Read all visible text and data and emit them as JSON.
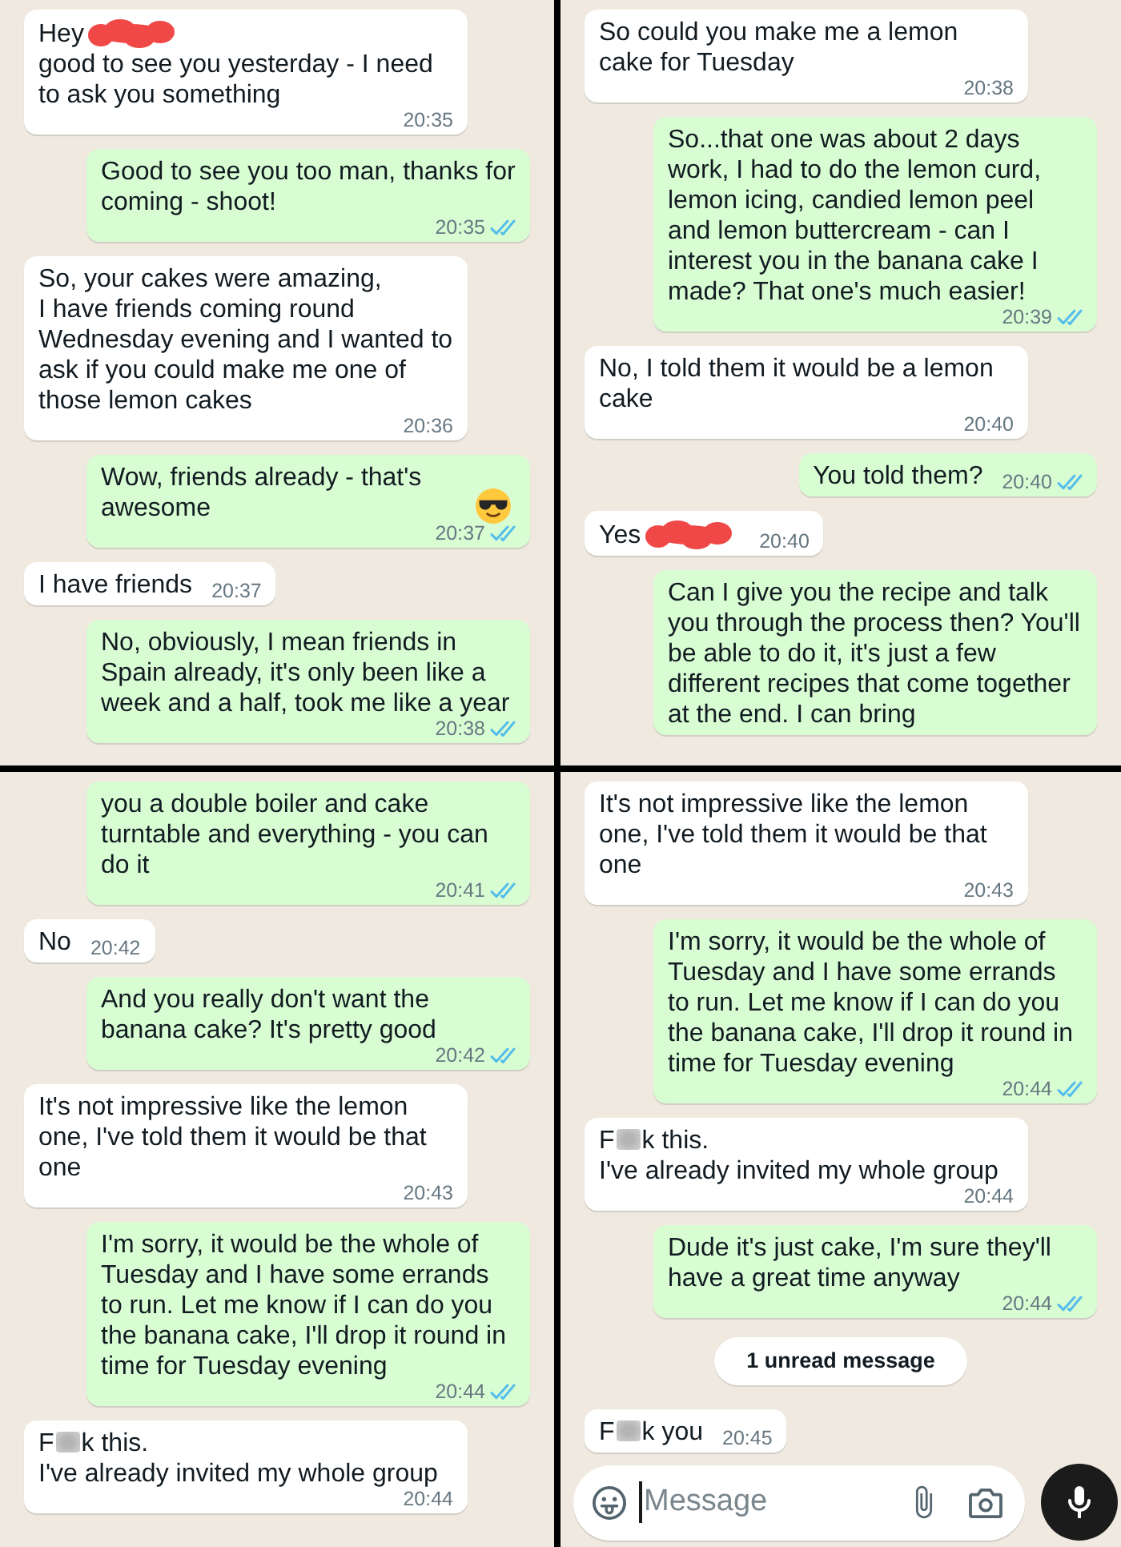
{
  "panels": [
    {
      "messages": [
        {
          "kind": "incoming",
          "segments": [
            {
              "kind": "text",
              "text": "Hey"
            },
            {
              "kind": "scribble"
            },
            {
              "kind": "text",
              "text": "good to see you yesterday - I need to ask you something"
            }
          ],
          "time": "20:35"
        },
        {
          "kind": "outgoing",
          "text": "Good to see you too man, thanks for coming - shoot!",
          "time": "20:35",
          "read": true
        },
        {
          "kind": "incoming",
          "text": "So, your cakes were amazing,\nI have friends coming round Wednesday evening and I wanted to ask if you could make me one of those lemon cakes",
          "time": "20:36"
        },
        {
          "kind": "outgoing",
          "segments": [
            {
              "kind": "text",
              "text": "Wow, friends already - that's awesome"
            },
            {
              "kind": "emoji"
            }
          ],
          "time": "20:37",
          "read": true
        },
        {
          "kind": "incoming",
          "text": "I have friends",
          "time": "20:37"
        },
        {
          "kind": "outgoing",
          "text": "No, obviously, I mean friends in Spain already, it's only been like a week and a half, took me like a year",
          "time": "20:38",
          "read": true
        }
      ]
    },
    {
      "messages": [
        {
          "kind": "incoming",
          "text": "So could you make me a lemon cake for Tuesday",
          "time": "20:38"
        },
        {
          "kind": "outgoing",
          "text": "So...that one was about 2 days work, I had to do the lemon curd, lemon icing, candied lemon peel and lemon buttercream - can I interest you in the banana cake I made? That one's much easier!",
          "time": "20:39",
          "read": true
        },
        {
          "kind": "incoming",
          "text": "No, I told them it would be a lemon cake",
          "time": "20:40"
        },
        {
          "kind": "outgoing",
          "text": "You told them?",
          "time": "20:40",
          "read": true
        },
        {
          "kind": "incoming",
          "segments": [
            {
              "kind": "text",
              "text": "Yes"
            },
            {
              "kind": "scribble"
            }
          ],
          "time": "20:40"
        },
        {
          "kind": "outgoing",
          "text": "Can I give you the recipe and talk you through the process then? You'll be able to do it, it's just a few different recipes that come together at the end. I can bring"
        }
      ]
    },
    {
      "messages": [
        {
          "kind": "outgoing",
          "text": "you a double boiler and cake turntable and everything - you can do it",
          "time": "20:41",
          "read": true
        },
        {
          "kind": "incoming",
          "text": "No",
          "time": "20:42"
        },
        {
          "kind": "outgoing",
          "text": "And you really don't want the banana cake? It's pretty good",
          "time": "20:42",
          "read": true
        },
        {
          "kind": "incoming",
          "text": "It's not impressive like the lemon one, I've told them it would be that one",
          "time": "20:43"
        },
        {
          "kind": "outgoing",
          "text": "I'm sorry, it would be the whole of Tuesday and I have some errands to run. Let me know if I can do you the banana cake, I'll drop it round in time for Tuesday evening",
          "time": "20:44",
          "read": true
        },
        {
          "kind": "incoming",
          "segments": [
            {
              "kind": "text",
              "text": "F"
            },
            {
              "kind": "blur"
            },
            {
              "kind": "text",
              "text": "k this."
            },
            {
              "kind": "text",
              "text": "I've already invited my whole group"
            }
          ],
          "time": "20:44"
        }
      ]
    },
    {
      "messages": [
        {
          "kind": "incoming",
          "text": "It's not impressive like the lemon one, I've told them it would be that one",
          "time": "20:43"
        },
        {
          "kind": "outgoing",
          "text": "I'm sorry, it would be the whole of Tuesday and I have some errands to run. Let me know if I can do you the banana cake, I'll drop it round in time for Tuesday evening",
          "time": "20:44",
          "read": true
        },
        {
          "kind": "incoming",
          "segments": [
            {
              "kind": "text",
              "text": "F"
            },
            {
              "kind": "blur"
            },
            {
              "kind": "text",
              "text": "k this."
            },
            {
              "kind": "text",
              "text": "I've already invited my whole group"
            }
          ],
          "time": "20:44"
        },
        {
          "kind": "outgoing",
          "text": "Dude it's just cake, I'm sure they'll have a great time anyway",
          "time": "20:44",
          "read": true
        },
        {
          "kind": "unread_notice",
          "text": "1 unread message"
        },
        {
          "kind": "incoming",
          "segments": [
            {
              "kind": "text",
              "text": "F"
            },
            {
              "kind": "blur"
            },
            {
              "kind": "text",
              "text": "k you"
            }
          ],
          "time": "20:45"
        }
      ],
      "composer": {
        "placeholder": "Message",
        "focused": true
      }
    }
  ]
}
